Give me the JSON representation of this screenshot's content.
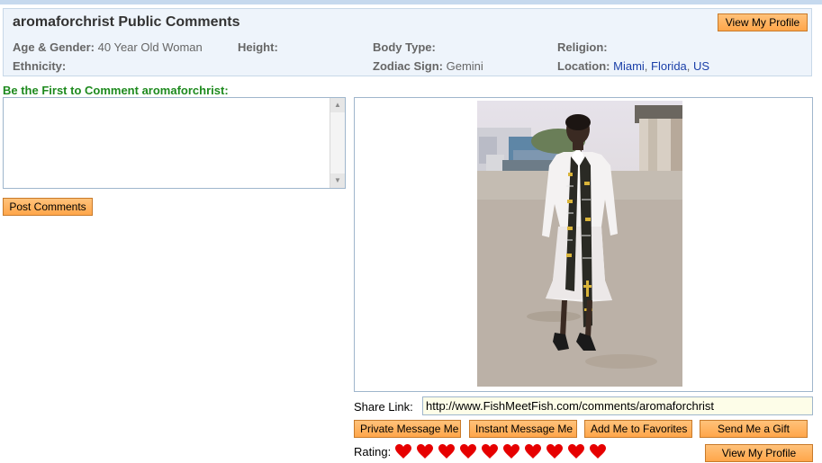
{
  "profile": {
    "title": "aromaforchrist Public Comments",
    "view_profile_label": "View My Profile",
    "fields": {
      "age_gender_label": "Age & Gender:",
      "age_gender_value": "40 Year Old Woman",
      "height_label": "Height:",
      "body_type_label": "Body Type:",
      "religion_label": "Religion:",
      "ethnicity_label": "Ethnicity:",
      "zodiac_label": "Zodiac Sign:",
      "zodiac_value": "Gemini",
      "location_label": "Location:",
      "location_city": "Miami",
      "location_state": "Florida",
      "location_country": "US",
      "location_sep": ","
    }
  },
  "comments": {
    "heading": "Be the First to Comment aromaforchrist:",
    "post_label": "Post Comments"
  },
  "share": {
    "label": "Share Link:",
    "url": "http://www.FishMeetFish.com/comments/aromaforchrist"
  },
  "actions": {
    "private_message": "Private Message Me",
    "instant_message": "Instant Message Me",
    "add_favorites": "Add Me to Favorites",
    "send_gift": "Send Me a Gift",
    "view_profile": "View My Profile"
  },
  "rating": {
    "label": "Rating:",
    "hearts": 10,
    "color": "#e60000"
  },
  "colors": {
    "button": "#ffa64a",
    "heading_green": "#1e8a1e",
    "link_blue": "#1a3fa8"
  }
}
